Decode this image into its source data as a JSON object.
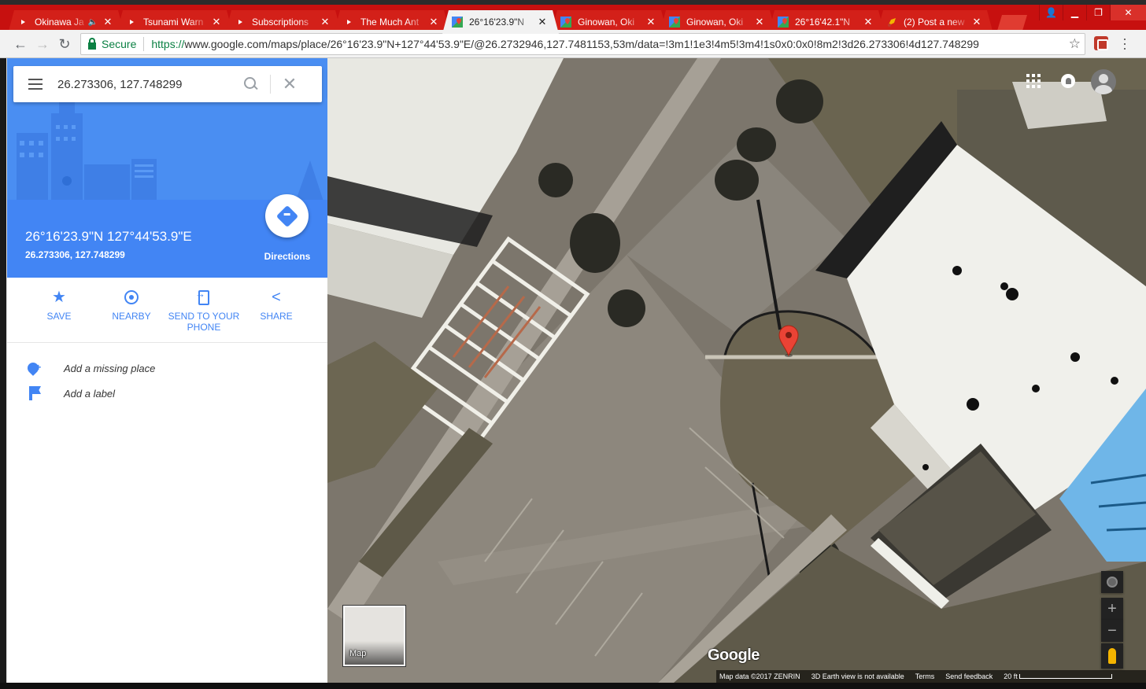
{
  "browser": {
    "tabs": [
      {
        "title": "Okinawa Ja",
        "icon": "youtube-icon",
        "audio": true
      },
      {
        "title": "Tsunami Warn",
        "icon": "youtube-icon"
      },
      {
        "title": "Subscriptions",
        "icon": "youtube-icon"
      },
      {
        "title": "The Much Ant",
        "icon": "youtube-icon"
      },
      {
        "title": "26°16'23.9\"N",
        "icon": "maps-icon",
        "active": true
      },
      {
        "title": "Ginowan, Oki",
        "icon": "maps-icon"
      },
      {
        "title": "Ginowan, Oki",
        "icon": "maps-icon"
      },
      {
        "title": "26°16'42.1\"N",
        "icon": "maps-icon"
      },
      {
        "title": "(2) Post a new",
        "icon": "forum-icon"
      }
    ],
    "close_glyph": "✕",
    "secure_label": "Secure",
    "url_proto": "https://",
    "url_rest": "www.google.com/maps/place/26°16'23.9\"N+127°44'53.9\"E/@26.2732946,127.7481153,53m/data=!3m1!1e3!4m5!3m4!1s0x0:0x0!8m2!3d26.273306!4d127.748299",
    "glyphs": {
      "back": "←",
      "forward": "→",
      "reload": "↻",
      "star": "☆",
      "speaker": "🔈",
      "minimize": "▁",
      "restore": "❐",
      "close": "✕",
      "profile": "👤"
    }
  },
  "sidebar": {
    "search_value": "26.273306, 127.748299",
    "clear_glyph": "✕",
    "title": "26°16'23.9\"N 127°44'53.9\"E",
    "subtitle": "26.273306, 127.748299",
    "directions_label": "Directions",
    "actions": [
      {
        "label": "SAVE",
        "icon": "star-icon",
        "glyph": "★"
      },
      {
        "label": "NEARBY",
        "icon": "nearby-icon"
      },
      {
        "label": "SEND TO YOUR PHONE",
        "icon": "send-to-phone-icon"
      },
      {
        "label": "SHARE",
        "icon": "share-icon",
        "glyph": "<"
      }
    ],
    "extras": [
      {
        "label": "Add a missing place",
        "icon": "add-place-icon"
      },
      {
        "label": "Add a label",
        "icon": "flag-icon"
      }
    ]
  },
  "map": {
    "view": "satellite",
    "minimap_label": "Map",
    "logo": "Google",
    "zoom_in": "+",
    "zoom_out": "−",
    "footer": {
      "copyright": "Map data ©2017 ZENRIN",
      "earth_note": "3D Earth view is not available",
      "terms": "Terms",
      "feedback": "Send feedback",
      "scale": "20 ft"
    },
    "marker_color": "#ea4335"
  },
  "colors": {
    "tab_bar": "#c7100f",
    "maps_blue": "#4285f4",
    "secure_green": "#0b8043"
  }
}
